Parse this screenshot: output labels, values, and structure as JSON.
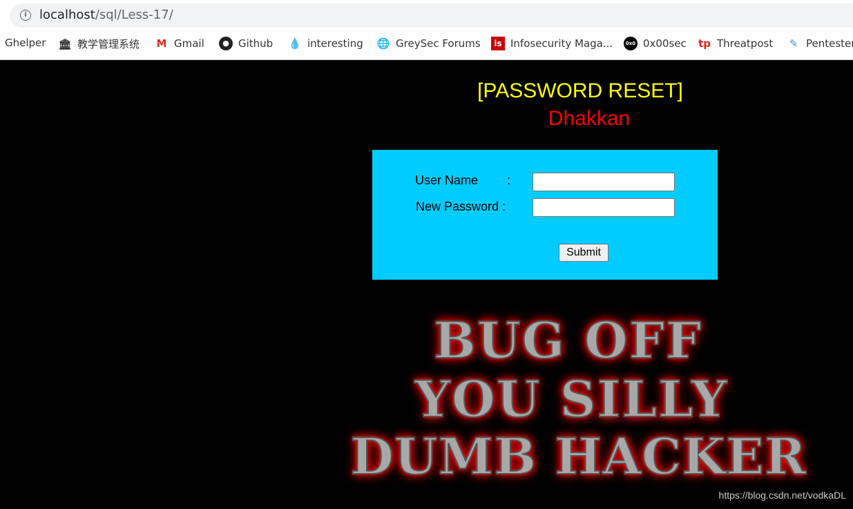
{
  "browser": {
    "url_host": "localhost",
    "url_path": "/sql/Less-17/",
    "bookmarks": [
      {
        "label": "Ghelper",
        "icon": ""
      },
      {
        "label": "教学管理系统",
        "icon": "building-icon"
      },
      {
        "label": "Gmail",
        "icon": "gmail-icon"
      },
      {
        "label": "Github",
        "icon": "github-icon"
      },
      {
        "label": "interesting",
        "icon": "drupal-icon"
      },
      {
        "label": "GreySec Forums",
        "icon": "globe-icon"
      },
      {
        "label": "Infosecurity Maga...",
        "icon": "infosecurity-icon"
      },
      {
        "label": "0x00sec",
        "icon": "0x00sec-icon"
      },
      {
        "label": "Threatpost",
        "icon": "threatpost-icon"
      },
      {
        "label": "Pentester",
        "icon": "pencil-icon"
      }
    ]
  },
  "page": {
    "title": "[PASSWORD RESET]",
    "subtitle": "Dhakkan",
    "form": {
      "username_label": "User Name",
      "colon": ":",
      "password_label": "New Password :",
      "username_value": "",
      "password_value": "",
      "submit": "Submit"
    },
    "banner_lines": [
      "BUG OFF",
      "YOU SILLY",
      "DUMB HACKER"
    ],
    "watermark": "https://blog.csdn.net/vodkaDL"
  },
  "colors": {
    "form_bg": "#00ccff",
    "title": "#ffff00",
    "subtitle": "#ff0000",
    "background": "#000000"
  }
}
